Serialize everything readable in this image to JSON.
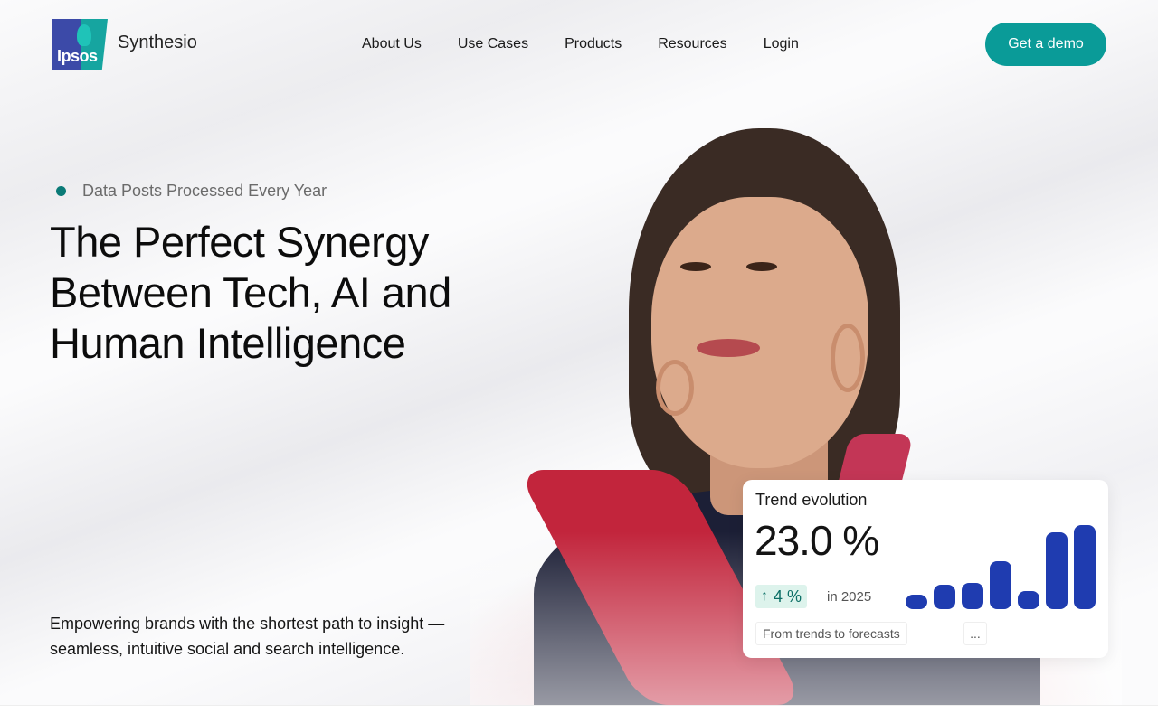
{
  "header": {
    "logo_text": "Ipsos",
    "brand": "Synthesio",
    "nav": [
      "About Us",
      "Use Cases",
      "Products",
      "Resources",
      "Login"
    ],
    "cta": "Get a demo"
  },
  "hero": {
    "eyebrow": "Data Posts Processed Every Year",
    "headline": "The Perfect Synergy Between Tech, AI and Human Intelligence",
    "subtext": "Empowering brands with the shortest path to insight — seamless, intuitive social and search intelligence."
  },
  "trend_card": {
    "title": "Trend evolution",
    "value": "23.0 %",
    "change": "4 %",
    "change_icon": "arrow-up-icon",
    "period": "in 2025",
    "tag": "From trends to forecasts",
    "more": "...",
    "bars": [
      16,
      26,
      28,
      51,
      19,
      83,
      90
    ],
    "bar_color": "#1f3cb0"
  },
  "colors": {
    "accent": "#0a9b98",
    "dot": "#0a7a77",
    "change_bg": "#ddf3ec"
  }
}
